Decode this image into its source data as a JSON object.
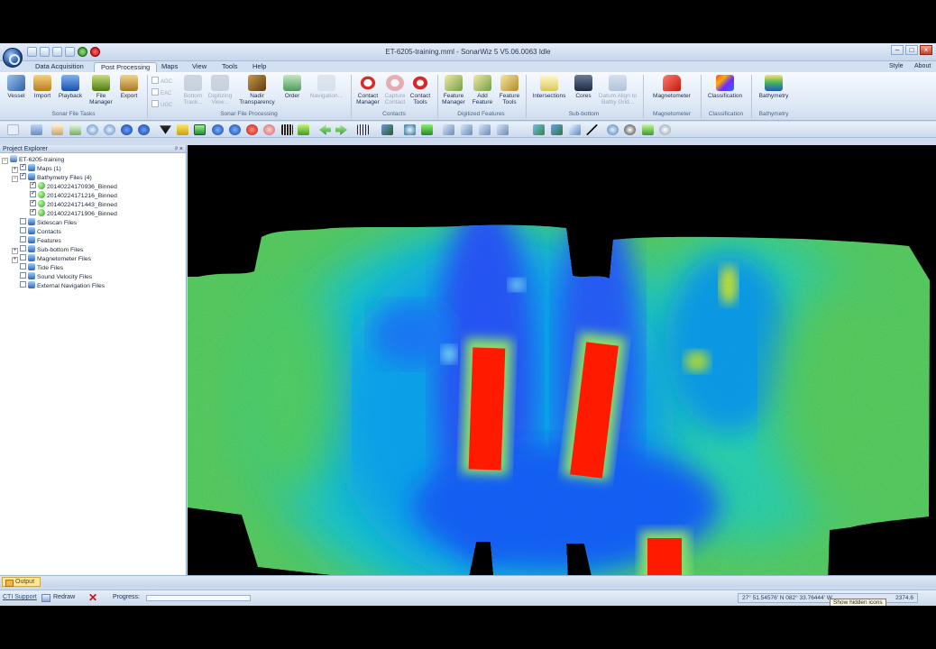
{
  "window": {
    "title": "ET-6205-training.mml - SonarWiz 5 V5.06.0063 Idle"
  },
  "tabs": [
    "Data Acquisition",
    "Post Processing",
    "Maps",
    "View",
    "Tools",
    "Help"
  ],
  "tabs_right": {
    "style": "Style",
    "about": "About"
  },
  "ribbon": {
    "sonar_file_tasks": {
      "label": "Sonar File Tasks",
      "buttons": [
        "Vessel",
        "Import",
        "Playback",
        "File Manager",
        "Export"
      ]
    },
    "sonar_file_processing": {
      "label": "Sonar File Processing",
      "checks": [
        "AGC",
        "EAC",
        "UGC"
      ],
      "buttons": [
        "Bottom Track...",
        "Digitizing View...",
        "Nadir Transparency",
        "Order",
        "Navigation..."
      ]
    },
    "contacts": {
      "label": "Contacts",
      "buttons": [
        "Contact Manager",
        "Capture Contact",
        "Contact Tools"
      ]
    },
    "digitized_features": {
      "label": "Digitized Features",
      "buttons": [
        "Feature Manager",
        "Add Feature",
        "Feature Tools"
      ]
    },
    "sub_bottom": {
      "label": "Sub-bottom",
      "buttons": [
        "Intersections",
        "Cores",
        "Datum Align to Bathy Grid..."
      ]
    },
    "magnetometer": {
      "label": "Magnetometer",
      "button": "Magnetometer"
    },
    "classification": {
      "label": "Classification",
      "button": "Classification"
    },
    "bathymetry": {
      "label": "Bathymetry",
      "button": "Bathymetry"
    }
  },
  "explorer": {
    "title": "Project Explorer",
    "pins": "ᵖ ×",
    "nodes": [
      {
        "label": "ET-6205-training",
        "level": 0,
        "expander": "⊟",
        "checked": false
      },
      {
        "label": "Maps (1)",
        "level": 1,
        "expander": "⊞",
        "checked": true
      },
      {
        "label": "Bathymetry Files (4)",
        "level": 1,
        "expander": "⊟",
        "checked": true
      },
      {
        "label": "20140224170936_Binned",
        "level": 2,
        "expander": "",
        "checked": true
      },
      {
        "label": "20140224171216_Binned",
        "level": 2,
        "expander": "",
        "checked": true
      },
      {
        "label": "20140224171443_Binned",
        "level": 2,
        "expander": "",
        "checked": true
      },
      {
        "label": "20140224171906_Binned",
        "level": 2,
        "expander": "",
        "checked": true
      },
      {
        "label": "Sidescan Files",
        "level": 1,
        "expander": "",
        "checked": false
      },
      {
        "label": "Contacts",
        "level": 1,
        "expander": "",
        "checked": false
      },
      {
        "label": "Features",
        "level": 1,
        "expander": "",
        "checked": false
      },
      {
        "label": "Sub-bottom Files",
        "level": 1,
        "expander": "⊞",
        "checked": false
      },
      {
        "label": "Magnetometer Files",
        "level": 1,
        "expander": "⊞",
        "checked": false
      },
      {
        "label": "Tide Files",
        "level": 1,
        "expander": "",
        "checked": false
      },
      {
        "label": "Sound Velocity Files",
        "level": 1,
        "expander": "",
        "checked": false
      },
      {
        "label": "External Navigation Files",
        "level": 1,
        "expander": "",
        "checked": false
      }
    ]
  },
  "output_tab": "Output",
  "status": {
    "ctisupport": "CTI Support",
    "redraw": "Redraw",
    "progress_label": "Progress:",
    "progress_value": 0,
    "coords": "27° 51.54576' N 082° 33.76444' W",
    "coords_tail": "2374.6",
    "tooltip": "Show hidden icons"
  },
  "colors": {
    "ribbon_bg": "#dde8f6",
    "map_bg": "#000000",
    "deep": "#1e3cff",
    "mid": "#17c6f0",
    "shallow": "#5ed35a",
    "high": "#ff1a00"
  }
}
